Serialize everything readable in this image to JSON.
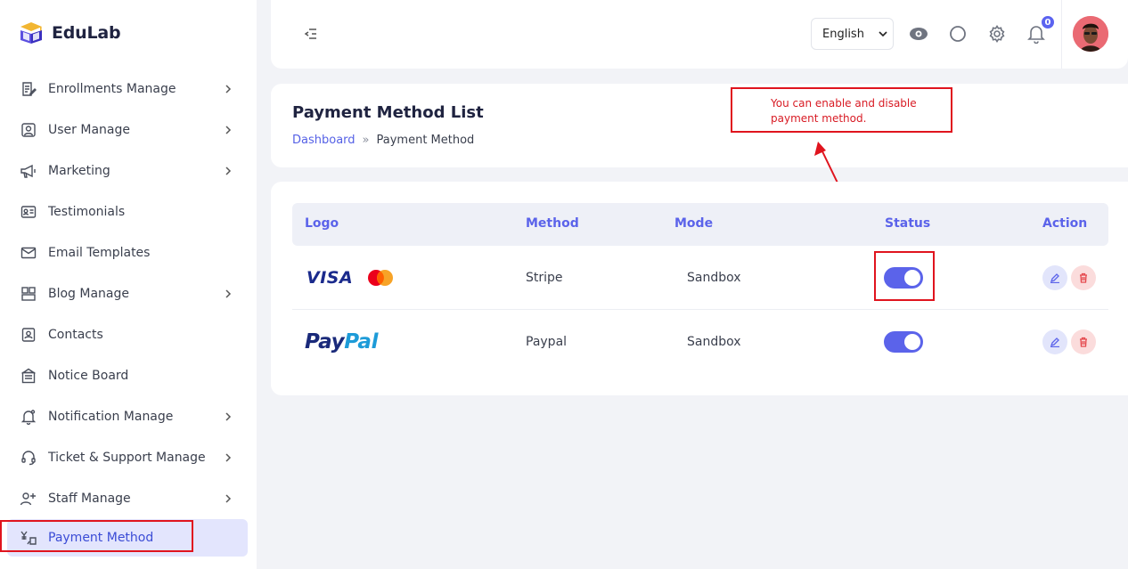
{
  "brand": {
    "name": "EduLab"
  },
  "sidebar": {
    "items": [
      {
        "label": "Enrollments Manage",
        "icon": "file-edit-icon",
        "has_submenu": true
      },
      {
        "label": "User Manage",
        "icon": "user-icon",
        "has_submenu": true
      },
      {
        "label": "Marketing",
        "icon": "megaphone-icon",
        "has_submenu": true
      },
      {
        "label": "Testimonials",
        "icon": "id-card-icon",
        "has_submenu": false
      },
      {
        "label": "Email Templates",
        "icon": "mail-icon",
        "has_submenu": false
      },
      {
        "label": "Blog Manage",
        "icon": "blog-icon",
        "has_submenu": true
      },
      {
        "label": "Contacts",
        "icon": "contact-icon",
        "has_submenu": false
      },
      {
        "label": "Notice Board",
        "icon": "notice-board-icon",
        "has_submenu": false
      },
      {
        "label": "Notification Manage",
        "icon": "bell-icon",
        "has_submenu": true
      },
      {
        "label": "Ticket & Support Manage",
        "icon": "headset-icon",
        "has_submenu": true
      },
      {
        "label": "Staff Manage",
        "icon": "user-plus-icon",
        "has_submenu": true
      },
      {
        "label": "Payment Method",
        "icon": "payment-icon",
        "has_submenu": false,
        "active": true
      }
    ]
  },
  "topbar": {
    "language": "English",
    "notification_count": "0"
  },
  "page": {
    "title": "Payment Method List",
    "breadcrumb": {
      "home": "Dashboard",
      "separator": "»",
      "current": "Payment Method"
    }
  },
  "annotation": {
    "text": "You can enable and disable payment method."
  },
  "table": {
    "headers": {
      "logo": "Logo",
      "method": "Method",
      "mode": "Mode",
      "status": "Status",
      "action": "Action"
    },
    "rows": [
      {
        "logo": "VISA",
        "method": "Stripe",
        "mode": "Sandbox",
        "enabled": true
      },
      {
        "logo_pay": "Pay",
        "logo_pal": "Pal",
        "method": "Paypal",
        "mode": "Sandbox",
        "enabled": true
      }
    ]
  },
  "colors": {
    "accent": "#5b63ea",
    "annotation": "#e0141e",
    "active_bg": "#e3e5fd"
  }
}
